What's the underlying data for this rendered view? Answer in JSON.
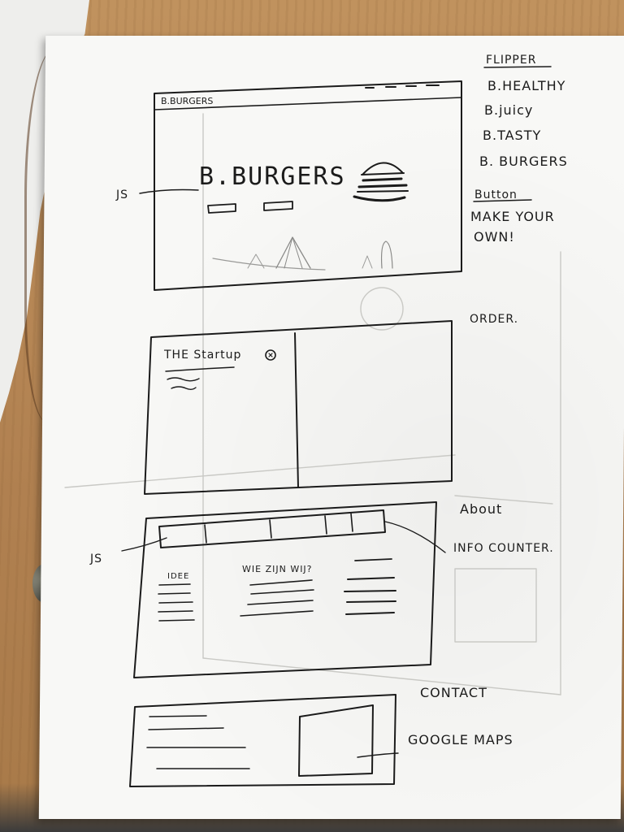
{
  "hero": {
    "browser_title": "B.BURGERS",
    "headline": "B.BURGERS",
    "annotation_js": "JS"
  },
  "flipper": {
    "heading": "FLIPPER",
    "items": [
      "B.HEALTHY",
      "B.juicy",
      "B.TASTY",
      "B. BURGERS"
    ],
    "button_heading": "Button",
    "button_text_line1": "MAKE YOUR",
    "button_text_line2": "OWN!"
  },
  "order": {
    "label": "ORDER.",
    "card_title": "THE Startup"
  },
  "about": {
    "label": "About",
    "info_counter": "INFO COUNTER.",
    "annotation_js": "JS",
    "col1_title": "IDEE",
    "col2_title": "WIE ZIJN WIJ?"
  },
  "contact": {
    "label": "CONTACT",
    "maps_label": "GOOGLE MAPS"
  }
}
